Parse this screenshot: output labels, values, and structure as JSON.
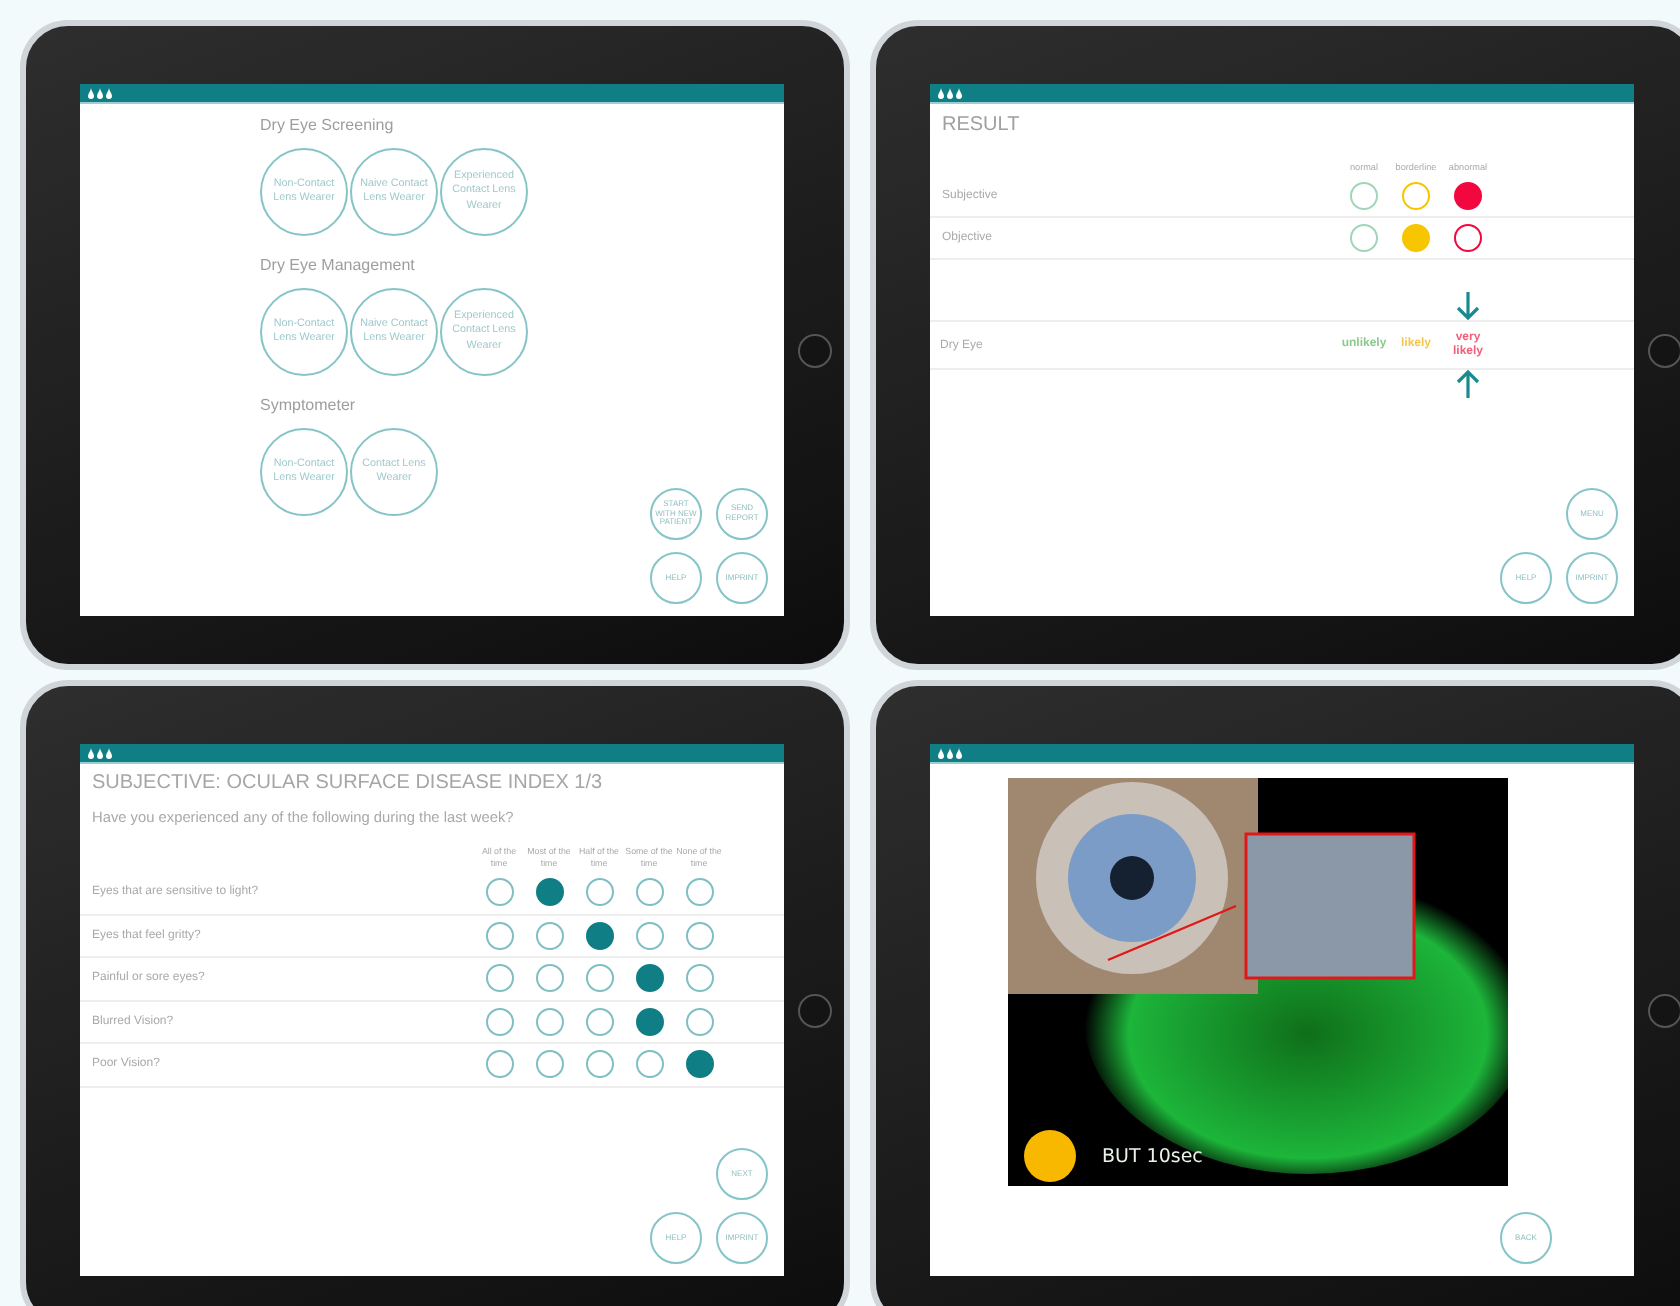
{
  "screens": [
    {
      "kind": "menu",
      "sections": [
        {
          "title": "Dry Eye Screening",
          "options": [
            "Non-Contact Lens Wearer",
            "Naive Contact Lens Wearer",
            "Experienced Contact Lens Wearer"
          ]
        },
        {
          "title": "Dry Eye Management",
          "options": [
            "Non-Contact Lens Wearer",
            "Naive Contact Lens Wearer",
            "Experienced Contact Lens Wearer"
          ]
        },
        {
          "title": "Symptometer",
          "options": [
            "Non-Contact Lens Wearer",
            "Contact Lens Wearer"
          ]
        }
      ],
      "buttons": [
        "START WITH NEW PATIENT",
        "SEND REPORT",
        "HELP",
        "IMPRINT"
      ]
    },
    {
      "kind": "result",
      "title": "RESULT",
      "columns": [
        {
          "label": "normal",
          "color": "#9fd6b8"
        },
        {
          "label": "borderline",
          "color": "#f7c600"
        },
        {
          "label": "abnormal",
          "color": "#f2073f"
        }
      ],
      "rows": [
        {
          "label": "Subjective",
          "dots": [
            {
              "selected": false
            },
            {
              "selected": false
            },
            {
              "selected": true
            }
          ]
        },
        {
          "label": "Objective",
          "dots": [
            {
              "selected": false
            },
            {
              "selected": true
            },
            {
              "selected": false
            }
          ]
        }
      ],
      "dry_eye": {
        "label": "Dry Eye",
        "outcomes": [
          {
            "label": "unlikely",
            "color": "#8cc98f",
            "selected": false
          },
          {
            "label": "likely",
            "color": "#f5c64a",
            "selected": false
          },
          {
            "label": "very likely",
            "color": "#f0607a",
            "selected": true
          }
        ]
      },
      "buttons": [
        "MENU",
        "HELP",
        "IMPRINT"
      ]
    },
    {
      "kind": "questionnaire",
      "title": "SUBJECTIVE: OCULAR SURFACE DISEASE INDEX 1/3",
      "question": "Have you experienced any of the following during the last week?",
      "columns": [
        "All of the time",
        "Most of the time",
        "Half of the time",
        "Some of the time",
        "None of the time"
      ],
      "rows": [
        {
          "label": "Eyes that are sensitive to light?",
          "choices": [
            {
              "selected": false
            },
            {
              "selected": true
            },
            {
              "selected": false
            },
            {
              "selected": false
            },
            {
              "selected": false
            }
          ]
        },
        {
          "label": "Eyes that feel gritty?",
          "choices": [
            {
              "selected": false
            },
            {
              "selected": false
            },
            {
              "selected": true
            },
            {
              "selected": false
            },
            {
              "selected": false
            }
          ]
        },
        {
          "label": "Painful or sore eyes?",
          "choices": [
            {
              "selected": false
            },
            {
              "selected": false
            },
            {
              "selected": false
            },
            {
              "selected": true
            },
            {
              "selected": false
            }
          ]
        },
        {
          "label": "Blurred Vision?",
          "choices": [
            {
              "selected": false
            },
            {
              "selected": false
            },
            {
              "selected": false
            },
            {
              "selected": true
            },
            {
              "selected": false
            }
          ]
        },
        {
          "label": "Poor Vision?",
          "choices": [
            {
              "selected": false
            },
            {
              "selected": false
            },
            {
              "selected": false
            },
            {
              "selected": false
            },
            {
              "selected": true
            }
          ]
        }
      ],
      "buttons": [
        "NEXT",
        "HELP",
        "IMPRINT"
      ]
    },
    {
      "kind": "photo",
      "caption": "BUT 10sec",
      "indicator": {
        "color": "#f9b800"
      },
      "buttons": [
        "BACK"
      ]
    }
  ]
}
